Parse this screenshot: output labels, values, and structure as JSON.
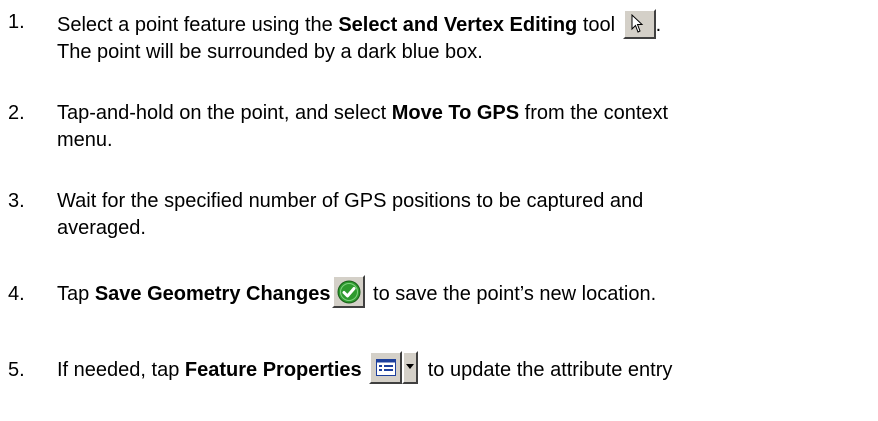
{
  "steps": [
    {
      "number": "1.",
      "line1_pre": "Select a point feature using the ",
      "line1_bold": "Select and Vertex Editing",
      "line1_post": " tool",
      "line1_end": ".",
      "line2": "The point will be surrounded by a dark blue box.",
      "icon": "cursor-arrow-icon"
    },
    {
      "number": "2.",
      "line1_pre": "Tap-and-hold on the point, and select ",
      "line1_bold": "Move To GPS",
      "line1_post": " from the context",
      "line2": "menu."
    },
    {
      "number": "3.",
      "line1": "Wait for the specified number of GPS positions to be captured and",
      "line2": "averaged."
    },
    {
      "number": "4.",
      "line1_pre": "Tap ",
      "line1_bold": "Save Geometry Changes",
      "line1_post": " to save the point’s new location.",
      "icon": "checkmark-save-icon"
    },
    {
      "number": "5.",
      "line1_pre": "If needed, tap ",
      "line1_bold": "Feature Properties",
      "line1_post": " to update the attribute entry",
      "icon": "feature-properties-icon"
    }
  ],
  "colors": {
    "text": "#000000",
    "button_face": "#d4d0c8",
    "check_green": "#2e9a2e"
  }
}
